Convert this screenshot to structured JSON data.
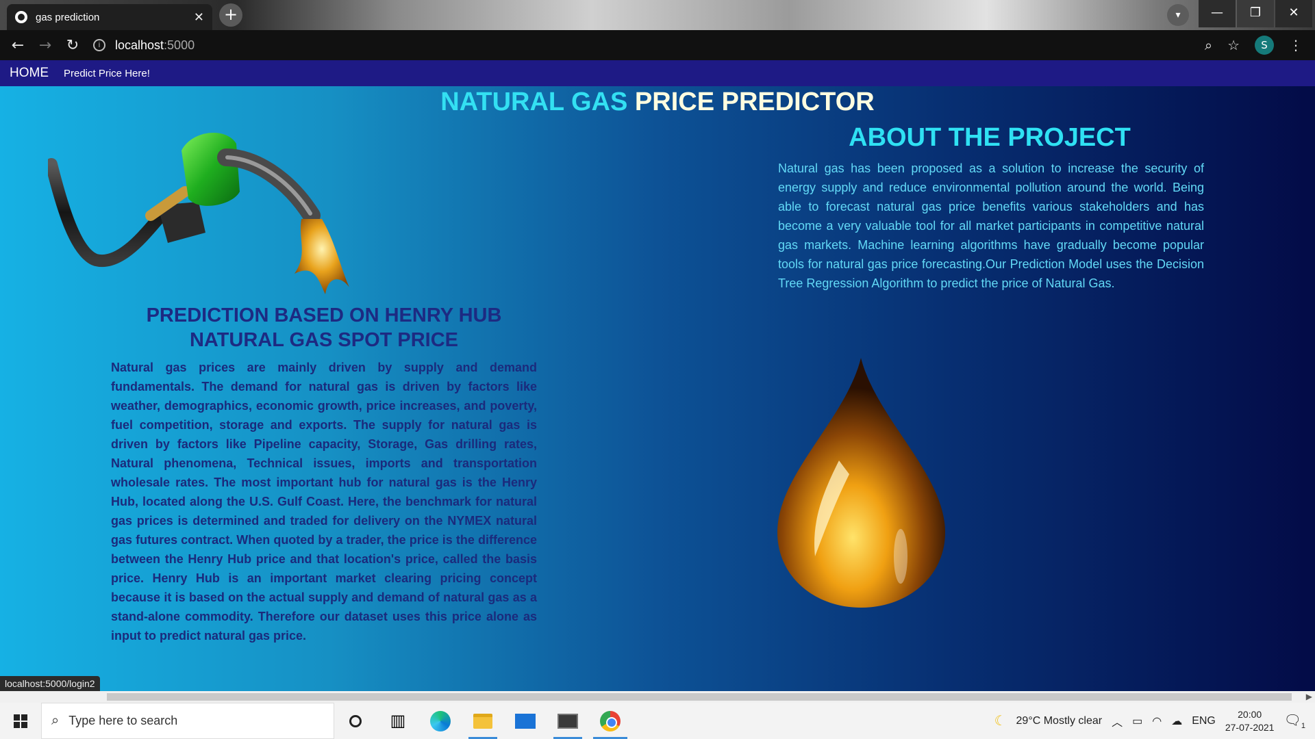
{
  "browser": {
    "tab_title": "gas prediction",
    "tab_close": "✕",
    "new_tab": "+",
    "url_host": "localhost",
    "url_port": ":5000",
    "status_url": "localhost:5000/login2"
  },
  "nav": {
    "home": "HOME",
    "predict": "Predict Price Here!"
  },
  "title": {
    "part1": "NATURAL GAS",
    "part2": "PRICE PREDICTOR"
  },
  "prediction": {
    "heading_line1": "PREDICTION BASED ON HENRY HUB",
    "heading_line2": "NATURAL GAS SPOT PRICE",
    "body": "Natural gas prices are mainly driven by supply and demand fundamentals. The demand for natural gas is driven by factors like weather, demographics, economic growth, price increases, and poverty, fuel competition, storage and exports. The supply for natural gas is driven by factors like Pipeline capacity, Storage, Gas drilling rates, Natural phenomena, Technical issues, imports and transportation wholesale rates. The most important hub for natural gas is the Henry Hub, located along the U.S. Gulf Coast. Here, the benchmark for natural gas prices is determined and traded for delivery on the NYMEX natural gas futures contract. When quoted by a trader, the price is the difference between the Henry Hub price and that location's price, called the basis price. Henry Hub is an important market clearing pricing concept because it is based on the actual supply and demand of natural gas as a stand-alone commodity. Therefore our dataset uses this price alone as input to predict natural gas price."
  },
  "about": {
    "heading": "ABOUT THE PROJECT",
    "body": "Natural gas has been proposed as a solution to increase the security of energy supply and reduce environmental pollution around the world. Being able to forecast natural gas price benefits various stakeholders and has become a very valuable tool for all market participants in competitive natural gas markets. Machine learning algorithms have gradually become popular tools for natural gas price forecasting.Our Prediction Model uses the Decision Tree Regression Algorithm to predict the price of Natural Gas."
  },
  "taskbar": {
    "search_placeholder": "Type here to search",
    "weather": "29°C  Mostly clear",
    "lang": "ENG",
    "time": "20:00",
    "date": "27-07-2021",
    "notif_count": "1"
  },
  "colors": {
    "title_cyan": "#33e0f2",
    "title_cream": "#fffde0",
    "nav_bg": "#1e1a85",
    "pred_text": "#1b2a7c",
    "about_text": "#62d9f6"
  }
}
